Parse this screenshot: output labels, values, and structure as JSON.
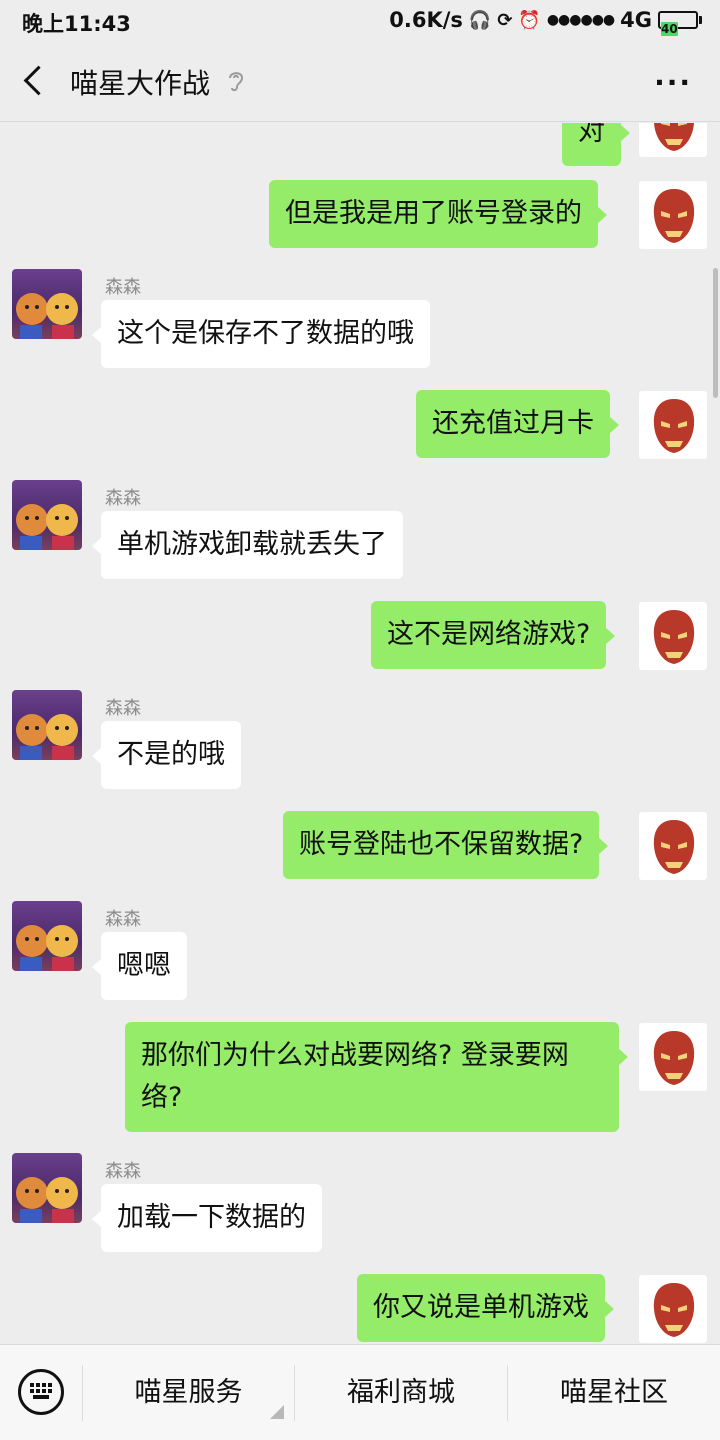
{
  "status_bar": {
    "time": "晚上11:43",
    "speed": "0.6K/s",
    "signal_dots": "●●●●●●",
    "network": "4G",
    "battery": "40"
  },
  "nav": {
    "title": "喵星大作战",
    "more": "···"
  },
  "messages": [
    {
      "from": "self",
      "text": "对"
    },
    {
      "from": "self",
      "text": "但是我是用了账号登录的"
    },
    {
      "from": "other",
      "sender": "森森",
      "text": "这个是保存不了数据的哦"
    },
    {
      "from": "self",
      "text": "还充值过月卡"
    },
    {
      "from": "other",
      "sender": "森森",
      "text": "单机游戏卸载就丢失了"
    },
    {
      "from": "self",
      "text": "这不是网络游戏?"
    },
    {
      "from": "other",
      "sender": "森森",
      "text": "不是的哦"
    },
    {
      "from": "self",
      "text": "账号登陆也不保留数据?"
    },
    {
      "from": "other",
      "sender": "森森",
      "text": "嗯嗯"
    },
    {
      "from": "self",
      "text": "那你们为什么对战要网络? 登录要网络?"
    },
    {
      "from": "other",
      "sender": "森森",
      "text": "加载一下数据的"
    },
    {
      "from": "self",
      "text": "你又说是单机游戏"
    }
  ],
  "menu": {
    "tabs": [
      "喵星服务",
      "福利商城",
      "喵星社区"
    ]
  },
  "colors": {
    "self_bubble": "#95ec69",
    "other_bubble": "#ffffff",
    "background": "#ededed"
  }
}
